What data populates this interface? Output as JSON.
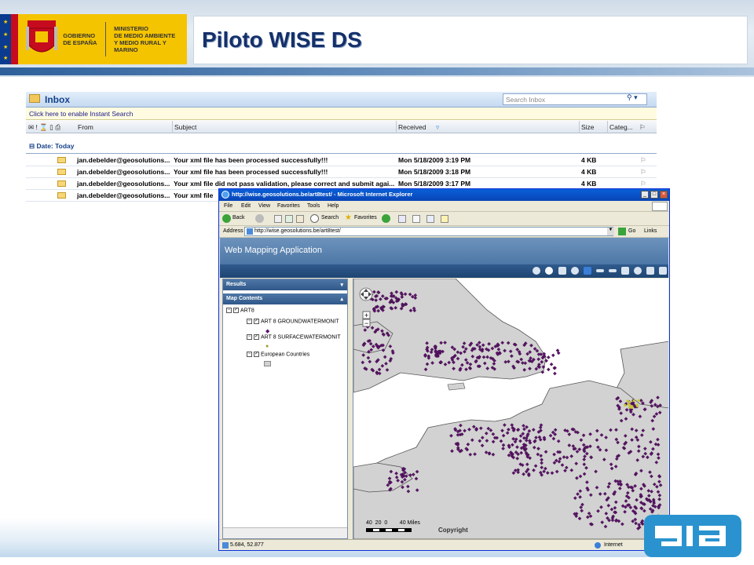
{
  "banner": {
    "org_line1": "Gobierno de España",
    "org_line2a": "Ministerio",
    "org_line2b": "de Medio Ambiente",
    "org_line2c": "y Medio Rural y Marino",
    "title": "Piloto WISE DS"
  },
  "outlook": {
    "folder": "Inbox",
    "search_placeholder": "Search Inbox",
    "instant_search": "Click here to enable Instant Search",
    "columns": {
      "from": "From",
      "subject": "Subject",
      "received": "Received",
      "size": "Size",
      "categories": "Categ..."
    },
    "group": "Date: Today",
    "rows": [
      {
        "from": "jan.debelder@geosolutions...",
        "subject": "Your xml file has been processed successfully!!!",
        "received": "Mon 5/18/2009 3:19 PM",
        "size": "4 KB"
      },
      {
        "from": "jan.debelder@geosolutions...",
        "subject": "Your xml file has been processed successfully!!!",
        "received": "Mon 5/18/2009 3:18 PM",
        "size": "4 KB"
      },
      {
        "from": "jan.debelder@geosolutions...",
        "subject": "Your xml file did not pass validation, please correct and submit agai...",
        "received": "Mon 5/18/2009 3:17 PM",
        "size": "4 KB"
      },
      {
        "from": "jan.debelder@geosolutions...",
        "subject": "Your xml file",
        "received": "",
        "size": ""
      }
    ]
  },
  "ie": {
    "window_title": "http://wise.geosolutions.be/art8test/ - Microsoft Internet Explorer",
    "menu": [
      "File",
      "Edit",
      "View",
      "Favorites",
      "Tools",
      "Help"
    ],
    "toolbar": {
      "back": "Back",
      "search": "Search",
      "favorites": "Favorites"
    },
    "address_label": "Address",
    "address_value": "http://wise.geosolutions.be/art8test/",
    "go": "Go",
    "links": "Links",
    "status_coords": "5.684, 52.877",
    "status_zone": "Internet"
  },
  "app": {
    "title": "Web Mapping Application",
    "results": "Results",
    "map_contents": "Map Contents",
    "layers": {
      "root": "ART8",
      "ground": "ART 8 GROUNDWATERMONIT",
      "surface": "ART 8 SURFACEWATERMONIT",
      "countries": "European Countries"
    },
    "scale_labels": "40  20  0        40 Miles",
    "copyright": "Copyright"
  },
  "colors": {
    "banner_blue": "#15306a",
    "point_purple": "#5a1468",
    "land_gray": "#d2d2d2",
    "gia_blue": "#2a93cf"
  }
}
